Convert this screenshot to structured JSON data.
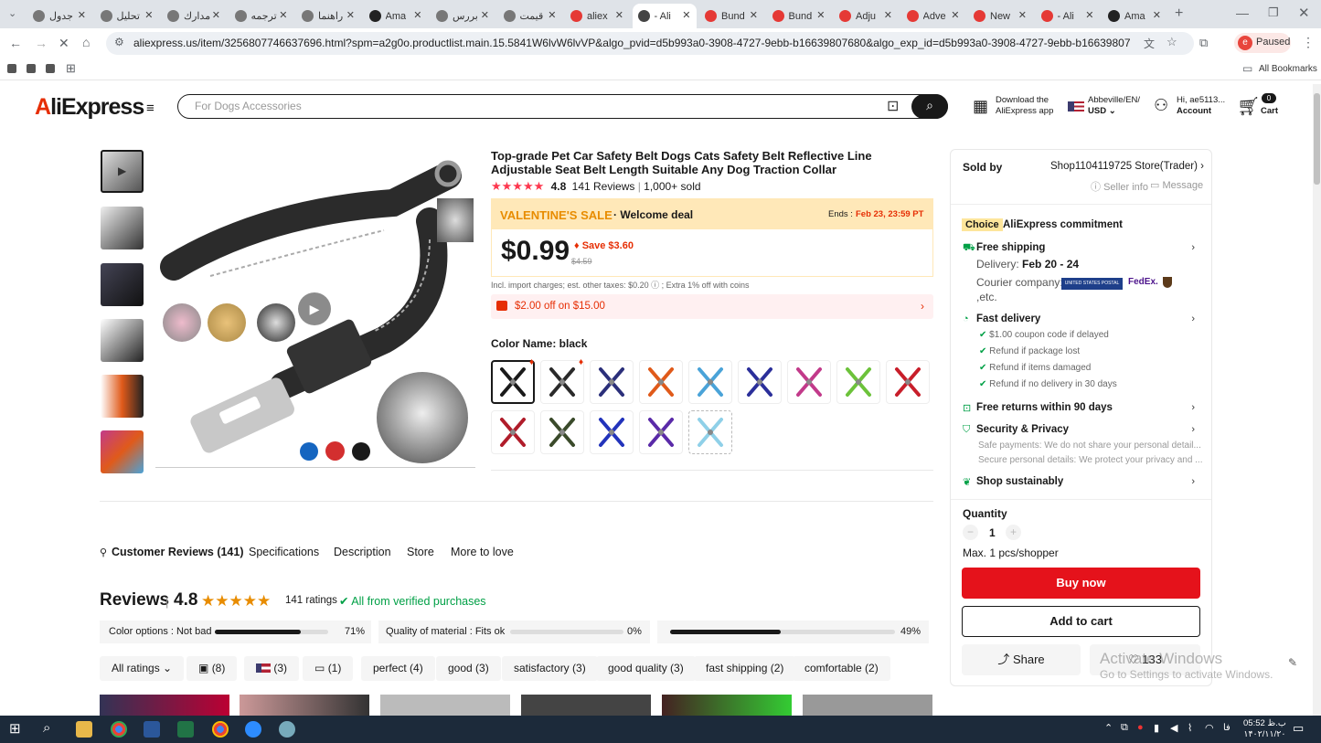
{
  "browser": {
    "tabs": [
      {
        "label": "جدول"
      },
      {
        "label": "تحليل"
      },
      {
        "label": "مدارك"
      },
      {
        "label": "ترجمه"
      },
      {
        "label": "راهنما"
      },
      {
        "label": "Ama"
      },
      {
        "label": "بررس"
      },
      {
        "label": "قيمت"
      },
      {
        "label": "aliex"
      },
      {
        "label": "- Ali"
      },
      {
        "label": "Bund"
      },
      {
        "label": "Bund"
      },
      {
        "label": "Adju"
      },
      {
        "label": "Adve"
      },
      {
        "label": "New"
      },
      {
        "label": "- Ali"
      },
      {
        "label": "Ama"
      }
    ],
    "url": "aliexpress.us/item/3256807746637696.html?spm=a2g0o.productlist.main.15.5841W6lvW6lvVP&algo_pvid=d5b993a0-3908-4727-9ebb-b16639807680&algo_exp_id=d5b993a0-3908-4727-9ebb-b16639807680-49&pdp_ext_f=%7B\"ord...",
    "profile_label": "Paused",
    "profile_initial": "e",
    "bookmarks_label": "All Bookmarks"
  },
  "header": {
    "logo": "AliExpress",
    "search_placeholder": "For Dogs Accessories",
    "download_app": "Download the",
    "download_app2": "AliExpress app",
    "locale": "Abbeville/EN/",
    "currency": "USD",
    "greeting": "Hi, ae5113...",
    "account": "Account",
    "cart_count": "0",
    "cart": "Cart"
  },
  "product": {
    "title": "Top-grade Pet Car Safety Belt Dogs Cats Safety Belt Reflective Line Adjustable Seat Belt Length Suitable Any Dog Traction Collar",
    "rating": "4.8",
    "reviews": "141 Reviews",
    "sold": "1,000+ sold",
    "promo_name": "VALENTINE'S SALE",
    "promo_deal": "· Welcome deal",
    "ends_label": "Ends :",
    "ends_date": "Feb 23, 23:59 PT",
    "price": "$0.99",
    "save": "Save $3.60",
    "old_price": "$4.59",
    "tax_note": "Incl. import charges; est. other taxes: $0.20 ⓘ ; Extra 1% off with coins",
    "coupon": "$2.00 off on $15.00",
    "color_label": "Color Name: black",
    "color_swatches": [
      "#1a1a1a",
      "#2a2a2a",
      "#2b2f7a",
      "#e05a1a",
      "#4aa3d8",
      "#2b2f9a",
      "#c23a8a",
      "#6cc23a",
      "#c81e2a",
      "#b01c2a",
      "#3a4a2a",
      "#2233bb",
      "#5a2aa8",
      "#8fd0e8"
    ]
  },
  "seller": {
    "sold_by": "Sold by",
    "store": "Shop1104119725 Store(Trader)",
    "seller_info": "Seller info",
    "message": "Message",
    "choice_badge": "Choice",
    "commitment": "AliExpress commitment",
    "free_shipping": "Free shipping",
    "delivery_label": "Delivery:",
    "delivery_date": "Feb 20 - 24",
    "courier": "Courier company:",
    "courier_etc": ",etc.",
    "usps": "UNITED STATES POSTAL SERVICE",
    "fedex": "FedEx.",
    "fast_delivery": "Fast delivery",
    "fast_items": [
      "$1.00 coupon code if delayed",
      "Refund if package lost",
      "Refund if items damaged",
      "Refund if no delivery in 30 days"
    ],
    "free_returns": "Free returns within 90 days",
    "security": "Security & Privacy",
    "security_items": [
      "Safe payments: We do not share your personal detail...",
      "Secure personal details: We protect your privacy and ..."
    ],
    "sustainably": "Shop sustainably",
    "quantity_label": "Quantity",
    "quantity": "1",
    "max_note": "Max. 1 pcs/shopper",
    "buy_now": "Buy now",
    "add_to_cart": "Add to cart",
    "share": "Share",
    "wishlist_count": "133",
    "watermark1": "Activate Windows",
    "watermark2": "Go to Settings to activate Windows."
  },
  "tabs_section": {
    "items": [
      "Customer Reviews (141)",
      "Specifications",
      "Description",
      "Store",
      "More to love"
    ]
  },
  "reviews": {
    "title": "Reviews",
    "score": "4.8",
    "ratings": "141 ratings",
    "verified": "All from verified purchases",
    "metrics": [
      {
        "label": "Color options : Not bad",
        "value": "71%",
        "fraction": 0.71
      },
      {
        "label": "Quality of material : Fits ok",
        "value": "0%",
        "fraction": 0.0
      },
      {
        "label": "",
        "value": "49%",
        "fraction": 0.49
      }
    ],
    "filters": [
      "All ratings",
      "(8)",
      "(3)",
      "(1)",
      "perfect (4)",
      "good (3)",
      "satisfactory (3)",
      "good quality (3)",
      "fast shipping (2)",
      "comfortable (2)"
    ]
  },
  "taskbar": {
    "time": "05:52 ب.ظ",
    "date": "۱۴۰۲/۱۱/۲۰"
  }
}
